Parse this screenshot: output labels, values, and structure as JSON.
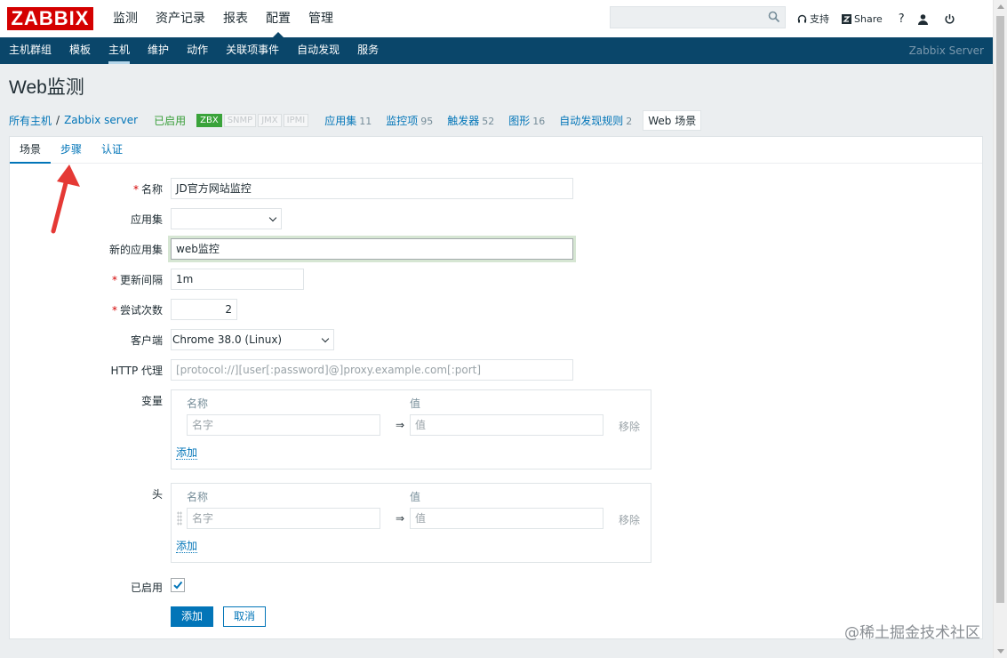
{
  "header": {
    "logo": "ZABBIX",
    "menu": [
      "监测",
      "资产记录",
      "报表",
      "配置",
      "管理"
    ],
    "active_menu_index": 3,
    "search_placeholder": "",
    "links": {
      "support": "支持",
      "share": "Share",
      "help": "?"
    }
  },
  "subnav": {
    "items": [
      "主机群组",
      "模板",
      "主机",
      "维护",
      "动作",
      "关联项事件",
      "自动发现",
      "服务"
    ],
    "active_index": 2,
    "server": "Zabbix Server"
  },
  "page": {
    "title": "Web监测"
  },
  "breadcrumb": {
    "all_hosts": "所有主机",
    "sep": "/",
    "host": "Zabbix server",
    "status": "已启用",
    "availability": [
      "ZBX",
      "SNMP",
      "JMX",
      "IPMI"
    ],
    "links": [
      {
        "label": "应用集",
        "count": "11"
      },
      {
        "label": "监控项",
        "count": "95"
      },
      {
        "label": "触发器",
        "count": "52"
      },
      {
        "label": "图形",
        "count": "16"
      },
      {
        "label": "自动发现规则",
        "count": "2"
      }
    ],
    "current": "Web 场景"
  },
  "tabs": [
    "场景",
    "步骤",
    "认证"
  ],
  "form": {
    "name": {
      "label": "名称",
      "value": "JD官方网站监控"
    },
    "app": {
      "label": "应用集",
      "value": ""
    },
    "new_app": {
      "label": "新的应用集",
      "value": "web监控"
    },
    "interval": {
      "label": "更新间隔",
      "value": "1m"
    },
    "attempts": {
      "label": "尝试次数",
      "value": "2"
    },
    "agent": {
      "label": "客户端",
      "value": "Chrome 38.0 (Linux)"
    },
    "proxy": {
      "label": "HTTP 代理",
      "placeholder": "[protocol://][user[:password]@]proxy.example.com[:port]"
    },
    "variables": {
      "label": "变量",
      "col_name": "名称",
      "col_value": "值",
      "name_placeholder": "名字",
      "value_placeholder": "值",
      "arrow": "⇒",
      "remove": "移除",
      "add": "添加"
    },
    "headers": {
      "label": "头",
      "col_name": "名称",
      "col_value": "值",
      "name_placeholder": "名字",
      "value_placeholder": "值",
      "arrow": "⇒",
      "remove": "移除",
      "add": "添加"
    },
    "enabled": {
      "label": "已启用",
      "checked": true
    },
    "buttons": {
      "add": "添加",
      "cancel": "取消"
    }
  },
  "watermark": "@稀土掘金技术社区",
  "colors": {
    "brand": "#d40000",
    "nav": "#0a466a",
    "link": "#0275b8",
    "ok": "#3aa33a",
    "annotation": "#e53935"
  }
}
